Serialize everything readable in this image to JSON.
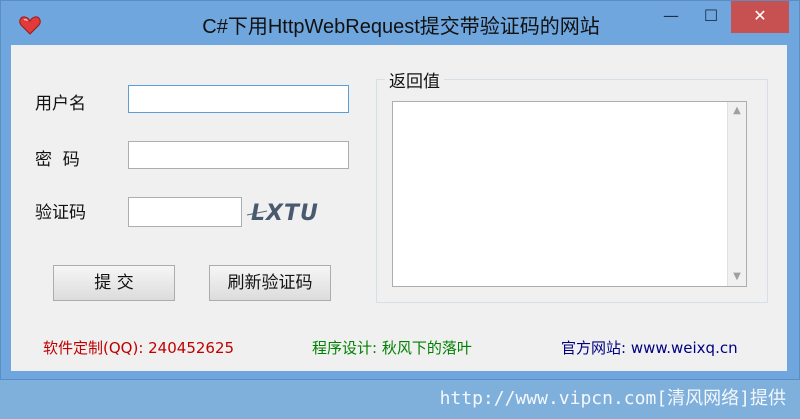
{
  "window": {
    "title": "C#下用HttpWebRequest提交带验证码的网站",
    "minimize_glyph": "—",
    "maximize_glyph": "☐",
    "close_glyph": "✕"
  },
  "form": {
    "username_label": "用户名",
    "password_label": "密  码",
    "captcha_label": "验证码",
    "username_value": "",
    "password_value": "",
    "captcha_value": "",
    "captcha_image_text": "LXTU",
    "submit_label": "提 交",
    "refresh_label": "刷新验证码"
  },
  "response": {
    "group_label": "返回值",
    "value": ""
  },
  "footer": {
    "custom": "软件定制(QQ): 240452625",
    "design": "程序设计: 秋风下的落叶",
    "site": "官方网站: www.weixq.cn"
  },
  "watermark": "http://www.vipcn.com[清风网络]提供",
  "colors": {
    "titlebar": "#6fa6dd",
    "client": "#f0f0f0",
    "custom_text": "#c00000",
    "design_text": "#008000",
    "site_text": "#000080",
    "close_button": "#c75050"
  },
  "icons": {
    "app": "heart-icon",
    "scroll_up": "chevron-up-icon",
    "scroll_down": "chevron-down-icon"
  }
}
